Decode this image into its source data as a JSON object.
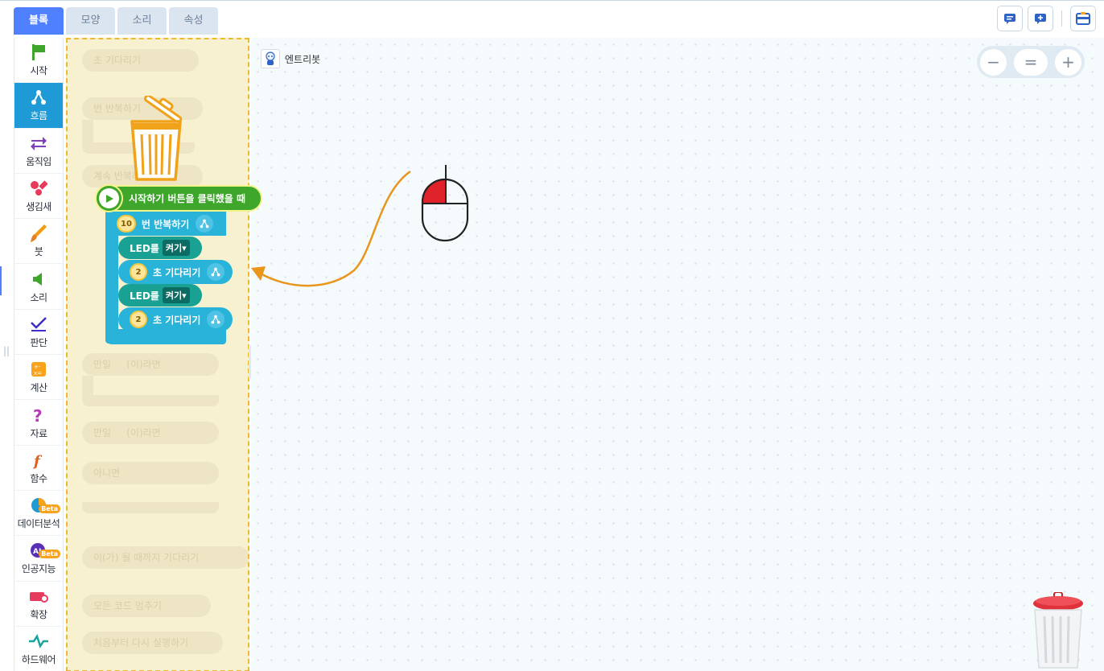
{
  "tabs": [
    {
      "label": "블록",
      "active": true
    },
    {
      "label": "모양",
      "active": false
    },
    {
      "label": "소리",
      "active": false
    },
    {
      "label": "속성",
      "active": false
    }
  ],
  "categories": [
    {
      "label": "시작",
      "icon": "flag-icon",
      "color": "#3da62b"
    },
    {
      "label": "흐름",
      "icon": "flow-icon",
      "color": "#ffffff",
      "active": true
    },
    {
      "label": "움직임",
      "icon": "move-arrows-icon",
      "color": "#8e44ad"
    },
    {
      "label": "생김새",
      "icon": "looks-shapes-icon",
      "color": "#e63b5c"
    },
    {
      "label": "붓",
      "icon": "brush-icon",
      "color": "#f39c12"
    },
    {
      "label": "소리",
      "icon": "speaker-icon",
      "color": "#3da62b"
    },
    {
      "label": "판단",
      "icon": "check-icon",
      "color": "#4a3cd6"
    },
    {
      "label": "계산",
      "icon": "calculator-icon",
      "color": "#f8a31b"
    },
    {
      "label": "자료",
      "icon": "question-icon",
      "color": "#b53ab5"
    },
    {
      "label": "함수",
      "icon": "function-icon",
      "color": "#e35d1b"
    },
    {
      "label": "데이터분석",
      "icon": "pie-chart-icon",
      "color": "#1e9bd6",
      "badge": "Beta"
    },
    {
      "label": "인공지능",
      "icon": "ai-icon",
      "color": "#6b3fc9",
      "badge": "Beta"
    },
    {
      "label": "확장",
      "icon": "extension-icon",
      "color": "#e63b5c"
    },
    {
      "label": "하드웨어",
      "icon": "hardware-icon",
      "color": "#1aa39c"
    }
  ],
  "workspace": {
    "object_name": "엔트리봇"
  },
  "zoom": {
    "minus": "−",
    "reset": "=",
    "plus": "+"
  },
  "palette_ghost_blocks": [
    "초 기다리기",
    "번 반복하기",
    "계속 반복하기",
    "만일",
    "(이)라면",
    "만일",
    "(이)라면",
    "아니면",
    "이(가) 될 때까지 기다리기",
    "모든",
    "코드 멈추기",
    "처음부터 다시 실행하기"
  ],
  "code": {
    "start_label": "시작하기 버튼을 클릭했을 때",
    "repeat_count": "10",
    "repeat_label": "번 반복하기",
    "led1_label": "LED를",
    "led1_value": "켜기▾",
    "wait1_value": "2",
    "wait1_label": "초 기다리기",
    "led2_label": "LED를",
    "led2_value": "켜기▾",
    "wait2_value": "2",
    "wait2_label": "초 기다리기"
  },
  "colors": {
    "accent": "#4f80ff",
    "flow": "#2ab3d9",
    "start_block": "#3da62b",
    "led_block": "#19a294",
    "drag_arrow": "#e8961c",
    "mouse_button": "#e0222a"
  }
}
